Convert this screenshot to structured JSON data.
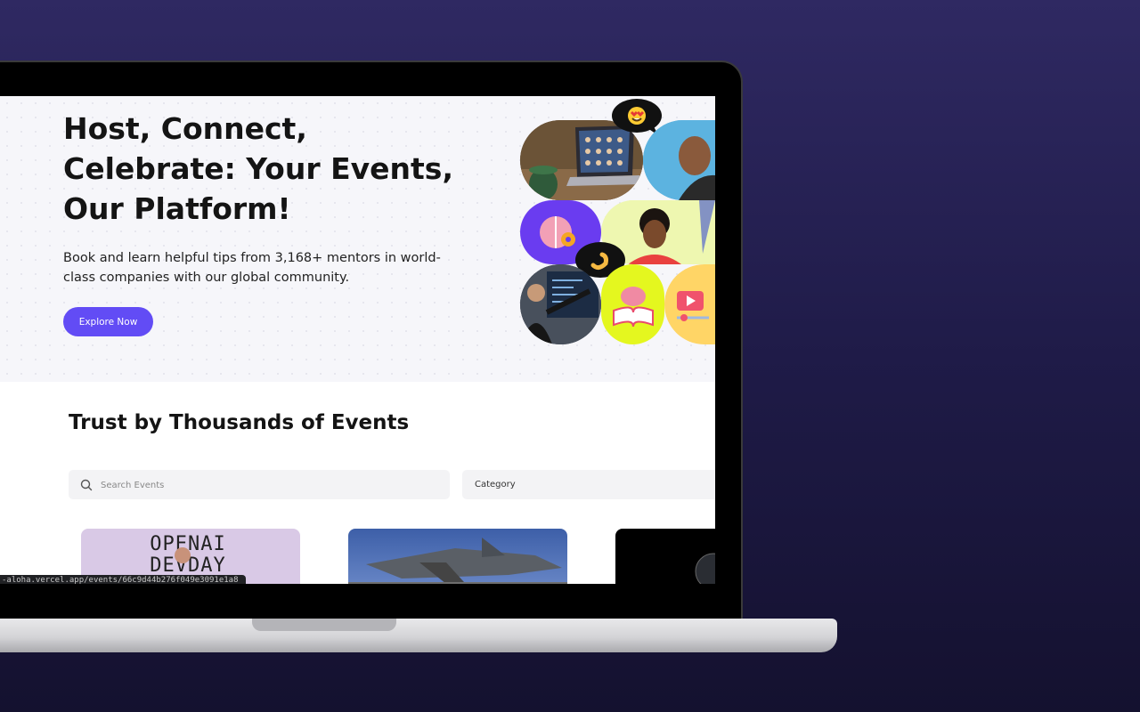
{
  "hero": {
    "title": "Host, Connect, Celebrate: Your Events, Our Platform!",
    "subtitle": "Book and learn helpful tips from 3,168+ mentors in world-class companies with our global community.",
    "cta_label": "Explore Now"
  },
  "events_section": {
    "title": "Trust by Thousands of Events",
    "search": {
      "placeholder": "Search Events",
      "value": ""
    },
    "category": {
      "selected": "Category"
    },
    "cards": [
      {
        "image_text": "OPENAI DEVDAY"
      },
      {
        "image_text": ""
      },
      {
        "image_text": ""
      }
    ]
  },
  "browser": {
    "status_url": "-aloha.vercel.app/events/66c9d44b276f049e3091e1a8"
  },
  "colors": {
    "accent": "#624cf5",
    "background": "#2f2962",
    "hero_background": "#f6f6fa"
  }
}
